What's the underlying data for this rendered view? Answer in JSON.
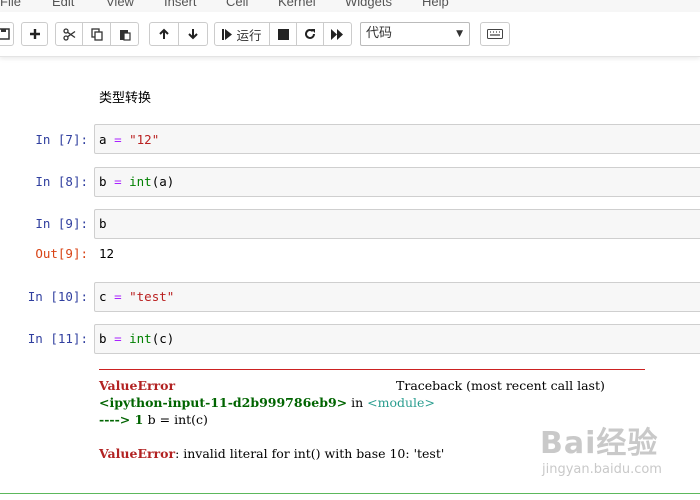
{
  "menu": [
    "File",
    "Edit",
    "View",
    "Insert",
    "Cell",
    "Kernel",
    "Widgets",
    "Help"
  ],
  "toolbar": {
    "run_label": "运行",
    "cell_type": "代码",
    "icons": [
      "save-icon",
      "add-icon",
      "cut-icon",
      "copy-icon",
      "paste-icon",
      "move-up-icon",
      "move-down-icon",
      "run-icon",
      "stop-icon",
      "restart-icon",
      "fast-forward-icon",
      "keyboard-icon"
    ]
  },
  "markdown": "类型转换",
  "cells": [
    {
      "prompt": "In  [7]:",
      "code": {
        "var": "a",
        "op": "=",
        "str": "\"12\""
      }
    },
    {
      "prompt": "In  [8]:",
      "code": {
        "var": "b",
        "op": "=",
        "fn": "int",
        "arg": "(a)"
      }
    },
    {
      "prompt": "In  [9]:",
      "code": {
        "var": "b"
      },
      "out_prompt": "Out[9]:",
      "output": "12"
    },
    {
      "prompt": "In  [10]:",
      "code": {
        "var": "c",
        "op": "=",
        "str": "\"test\""
      }
    },
    {
      "prompt": "In  [11]:",
      "code": {
        "var": "b",
        "op": "=",
        "fn": "int",
        "arg": "(c)"
      }
    }
  ],
  "traceback": {
    "error_name": "ValueError",
    "header_right": "Traceback (most recent call last)",
    "location": "<ipython-input-11-d2b999786eb9>",
    "in_word": " in ",
    "module": "<module>",
    "arrow_line": "----> 1 ",
    "arrow_code_var": "b",
    "arrow_code_op": " = ",
    "arrow_code_fn": "int",
    "arrow_code_arg": "(c)",
    "message": ": invalid literal for int() with base 10: 'test'"
  },
  "watermark": {
    "brand": "Bai经验",
    "url": "jingyan.baidu.com"
  }
}
